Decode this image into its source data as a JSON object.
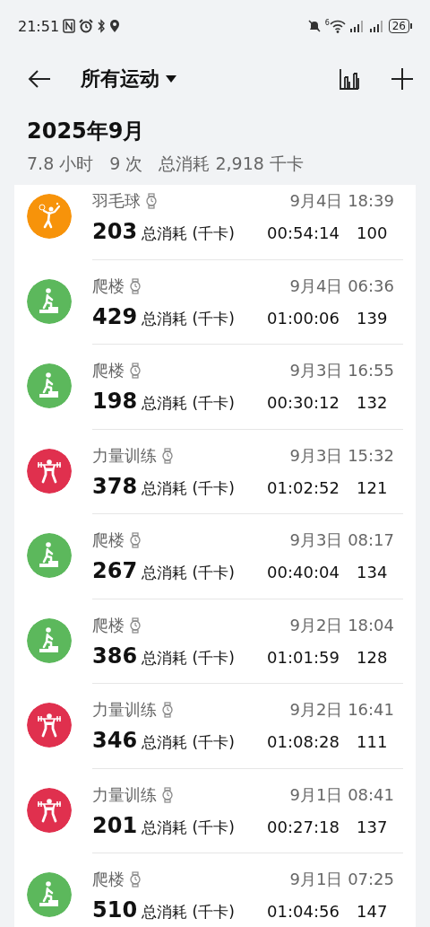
{
  "status_bar": {
    "time": "21:51",
    "wifi_label": "6",
    "battery": "26"
  },
  "header": {
    "title": "所有运动"
  },
  "month": {
    "title": "2025年9月",
    "duration": "7.8 小时",
    "count": "9 次",
    "total": "总消耗 2,918 千卡"
  },
  "workouts": [
    {
      "kind": "badminton",
      "name": "羽毛球",
      "date": "9月4日 18:39",
      "calories": "203",
      "calories_label": "总消耗 (千卡)",
      "duration": "00:54:14",
      "column_4": "100"
    },
    {
      "kind": "stairs",
      "name": "爬楼",
      "date": "9月4日 06:36",
      "calories": "429",
      "calories_label": "总消耗 (千卡)",
      "duration": "01:00:06",
      "column_4": "139"
    },
    {
      "kind": "stairs",
      "name": "爬楼",
      "date": "9月3日 16:55",
      "calories": "198",
      "calories_label": "总消耗 (千卡)",
      "duration": "00:30:12",
      "column_4": "132"
    },
    {
      "kind": "strength",
      "name": "力量训练",
      "date": "9月3日 15:32",
      "calories": "378",
      "calories_label": "总消耗 (千卡)",
      "duration": "01:02:52",
      "column_4": "121"
    },
    {
      "kind": "stairs",
      "name": "爬楼",
      "date": "9月3日 08:17",
      "calories": "267",
      "calories_label": "总消耗 (千卡)",
      "duration": "00:40:04",
      "column_4": "134"
    },
    {
      "kind": "stairs",
      "name": "爬楼",
      "date": "9月2日 18:04",
      "calories": "386",
      "calories_label": "总消耗 (千卡)",
      "duration": "01:01:59",
      "column_4": "128"
    },
    {
      "kind": "strength",
      "name": "力量训练",
      "date": "9月2日 16:41",
      "calories": "346",
      "calories_label": "总消耗 (千卡)",
      "duration": "01:08:28",
      "column_4": "111"
    },
    {
      "kind": "strength",
      "name": "力量训练",
      "date": "9月1日 08:41",
      "calories": "201",
      "calories_label": "总消耗 (千卡)",
      "duration": "00:27:18",
      "column_4": "137"
    },
    {
      "kind": "stairs",
      "name": "爬楼",
      "date": "9月1日 07:25",
      "calories": "510",
      "calories_label": "总消耗 (千卡)",
      "duration": "01:04:56",
      "column_4": "147"
    }
  ]
}
